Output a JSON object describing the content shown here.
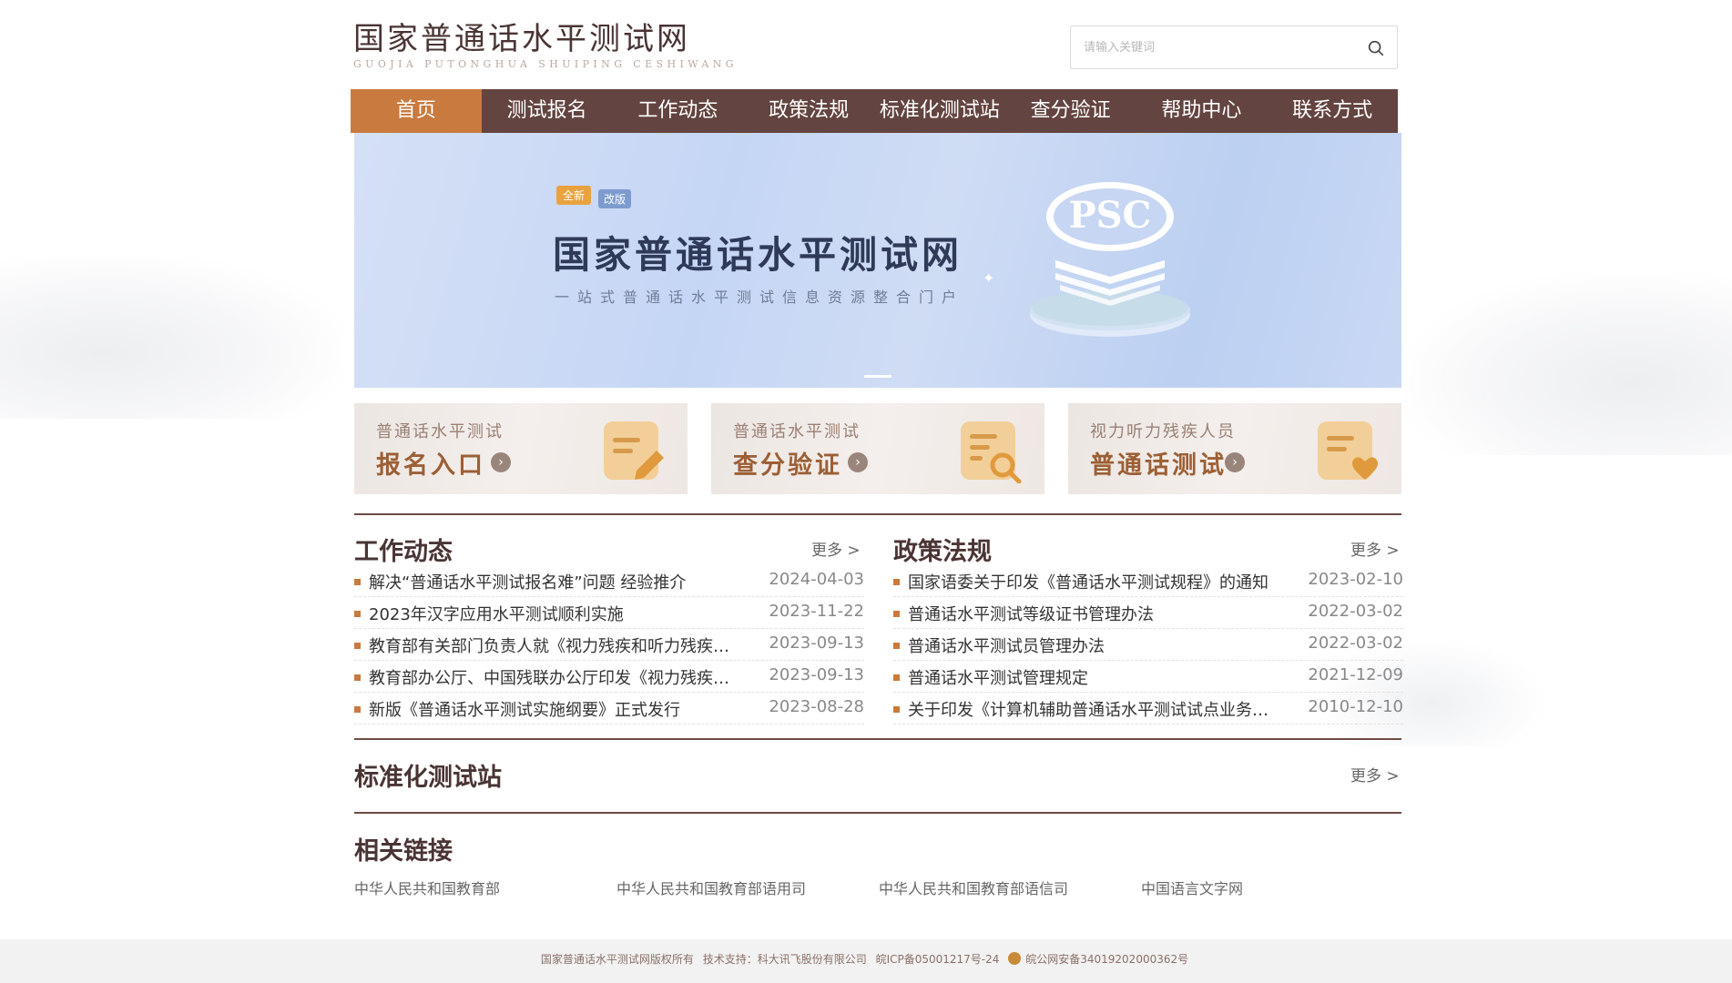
{
  "header": {
    "logo_cn": "国家普通话水平测试网",
    "logo_pinyin": "GUOJIA PUTONGHUA SHUIPING CESHIWANG",
    "search_placeholder": "请输入关键词",
    "search_icon": "search-icon"
  },
  "nav": {
    "items": [
      {
        "label": "首页",
        "active": true
      },
      {
        "label": "测试报名",
        "active": false
      },
      {
        "label": "工作动态",
        "active": false
      },
      {
        "label": "政策法规",
        "active": false
      },
      {
        "label": "标准化测试站",
        "active": false
      },
      {
        "label": "查分验证",
        "active": false
      },
      {
        "label": "帮助中心",
        "active": false
      },
      {
        "label": "联系方式",
        "active": false
      }
    ]
  },
  "banner": {
    "tag_new": "全新",
    "tag_revised": "改版",
    "title": "国家普通话水平测试网",
    "subtitle": "一站式普通话水平测试信息资源整合门户",
    "emblem_text": "PSC"
  },
  "cards": [
    {
      "small": "普通话水平测试",
      "big": "报名入口",
      "icon": "edit-note-icon"
    },
    {
      "small": "普通话水平测试",
      "big": "查分验证",
      "icon": "search-document-icon"
    },
    {
      "small": "视力听力残疾人员",
      "big": "普通话测试",
      "icon": "heart-document-icon"
    }
  ],
  "sections": {
    "work": {
      "title": "工作动态",
      "more": "更多 >",
      "items": [
        {
          "title": "解决“普通话水平测试报名难”问题 经验推介",
          "date": "2024-04-03"
        },
        {
          "title": "2023年汉字应用水平测试顺利实施",
          "date": "2023-11-22"
        },
        {
          "title": "教育部有关部门负责人就《视力残疾和听力残疾…",
          "date": "2023-09-13"
        },
        {
          "title": "教育部办公厅、中国残联办公厅印发《视力残疾…",
          "date": "2023-09-13"
        },
        {
          "title": "新版《普通话水平测试实施纲要》正式发行",
          "date": "2023-08-28"
        }
      ]
    },
    "policy": {
      "title": "政策法规",
      "more": "更多 >",
      "items": [
        {
          "title": "国家语委关于印发《普通话水平测试规程》的通知",
          "date": "2023-02-10"
        },
        {
          "title": "普通话水平测试等级证书管理办法",
          "date": "2022-03-02"
        },
        {
          "title": "普通话水平测试员管理办法",
          "date": "2022-03-02"
        },
        {
          "title": "普通话水平测试管理规定",
          "date": "2021-12-09"
        },
        {
          "title": "关于印发《计算机辅助普通话水平测试试点业务…",
          "date": "2010-12-10"
        }
      ]
    },
    "stations": {
      "title": "标准化测试站",
      "more": "更多 >"
    },
    "links": {
      "title": "相关链接",
      "items": [
        "中华人民共和国教育部",
        "中华人民共和国教育部语用司",
        "中华人民共和国教育部语信司",
        "中国语言文字网"
      ]
    }
  },
  "footer": {
    "copyright": "国家普通话水平测试网版权所有",
    "tech": "技术支持：科大讯飞股份有限公司",
    "icp": "皖ICP备05001217号-24",
    "police": "皖公网安备34019202000362号"
  },
  "colors": {
    "nav_bg": "#634440",
    "nav_active": "#c97a3e",
    "accent": "#c97a3e",
    "title": "#4a3434"
  }
}
